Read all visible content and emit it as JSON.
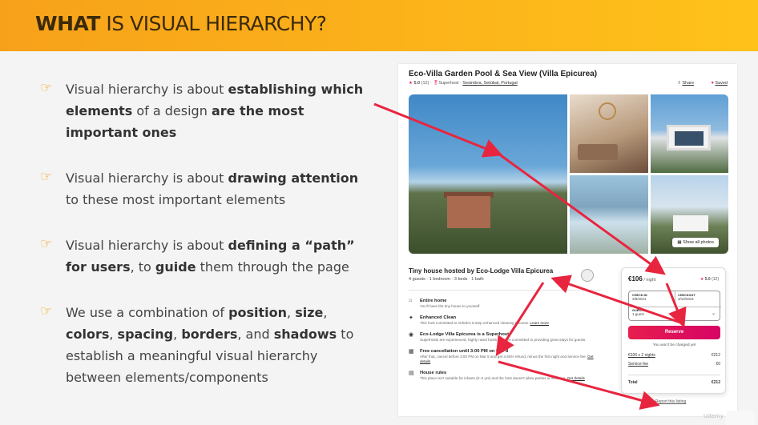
{
  "slide": {
    "title_bold": "WHAT",
    "title_rest": " IS VISUAL HIERARCHY?",
    "bullet_icon": "pointing-hand-icon",
    "bullets": [
      {
        "pre": "Visual hierarchy is about ",
        "b1": "establishing which elements",
        "mid": " of a design ",
        "b2": "are the most important ones",
        "post": ""
      },
      {
        "pre": "Visual hierarchy is about ",
        "b1": "drawing attention",
        "mid": " to these most important elements",
        "b2": "",
        "post": ""
      },
      {
        "pre": "Visual hierarchy is about ",
        "b1": "defining a “path” for users",
        "mid": ", to ",
        "b2": "guide",
        "post": " them through the page"
      },
      {
        "pre": "We use a combination of ",
        "b1": "position",
        "mid": ", ",
        "b2": "size",
        "post": ""
      }
    ],
    "bullet4": {
      "pre": "We use a combination of ",
      "w1": "position",
      "s1": ", ",
      "w2": "size",
      "s2": ", ",
      "w3": "colors",
      "s3": ", ",
      "w4": "spacing",
      "s4": ", ",
      "w5": "borders",
      "s5": ", and ",
      "w6": "shadows",
      "post": " to establish a meaningful visual hierarchy between elements/components"
    }
  },
  "listing": {
    "title": "Eco-Villa Garden Pool & Sea View (Villa Epicurea)",
    "rating": "5.0",
    "reviews": "(12)",
    "superhost": "Superhost",
    "location": "Sesimbra, Setúbal, Portugal",
    "share": "Share",
    "saved": "Saved",
    "show_all": "Show all photos",
    "host_title": "Tiny house hosted by Eco-Lodge Villa Epicurea",
    "host_meta": "4 guests · 1 bedroom · 3 beds · 1 bath",
    "features": [
      {
        "icon": "home-icon",
        "title": "Entire home",
        "desc": "You'll have the tiny house to yourself.",
        "link": ""
      },
      {
        "icon": "sparkle-icon",
        "title": "Enhanced Clean",
        "desc": "This host committed to Airbnb's 5-step enhanced cleaning process.",
        "link": "Learn more"
      },
      {
        "icon": "medal-icon",
        "title": "Eco-Lodge Villa Epicurea is a Superhost",
        "desc": "Superhosts are experienced, highly rated hosts who are committed to providing great stays for guests.",
        "link": ""
      },
      {
        "icon": "calendar-icon",
        "title": "Free cancellation until 3:00 PM on Mar 8",
        "desc": "After that, cancel before 3:00 PM on Mar 9 and get a 50% refund, minus the first night and service fee.",
        "link": "Get details"
      },
      {
        "icon": "rules-icon",
        "title": "House rules",
        "desc": "This place isn't suitable for infants (0–2 yrs) and the host doesn't allow parties or smoking.",
        "link": "Get details"
      }
    ],
    "booking": {
      "price": "€106",
      "per": " / night",
      "rating": "5.0",
      "reviews": "(12)",
      "checkin_label": "CHECK-IN",
      "checkin_value": "3/8/2021",
      "checkout_label": "CHECKOUT",
      "checkout_value": "3/10/2021",
      "guests_label": "GUESTS",
      "guests_value": "1 guest",
      "reserve": "Reserve",
      "note": "You won't be charged yet",
      "nights_label": "€106 x 2 nights",
      "nights_value": "€212",
      "fee_label": "Service fee",
      "fee_value": "€0",
      "total_label": "Total",
      "total_value": "€212"
    },
    "report": "Report this listing"
  },
  "watermark": "Udemy",
  "colors": {
    "banner_start": "#f7a11a",
    "banner_end": "#ffc21a",
    "accent": "#f5a315",
    "airbnb": "#e61e4d",
    "arrow": "#e8253f"
  }
}
